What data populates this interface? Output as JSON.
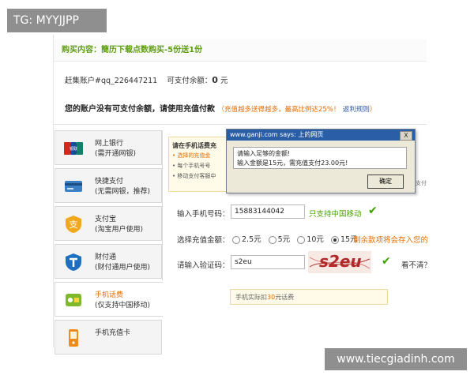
{
  "watermarks": {
    "top": "TG: MYYJJPP",
    "bottom": "www.tiecgiadinh.com"
  },
  "purchase": {
    "text": "购买内容：簡历下载点数购买-5份送1份"
  },
  "account": {
    "label": "赶集账户#qq_226447211",
    "balance_label": "可支付余额：",
    "balance_value": "0",
    "balance_unit": "元"
  },
  "notice": {
    "main": "您的账户没有可支付余额，请使用充值付款",
    "hint": "（充值越多送得越多，最高比例达25%！",
    "rules": "返利规则",
    "end": "）"
  },
  "methods": [
    {
      "line1": "网上银行",
      "line2": "(需开通网银)",
      "icon": "unionpay-icon"
    },
    {
      "line1": "快捷支付",
      "line2": "(无需网银，推荐)",
      "icon": "card-icon"
    },
    {
      "line1": "支付宝",
      "line2": "(淘宝用户使用)",
      "icon": "alipay-icon"
    },
    {
      "line1": "财付通",
      "line2": "(财付通用户使用)",
      "icon": "tenpay-icon"
    },
    {
      "line1": "手机话费",
      "line2": "(仅支持中国移动)",
      "icon": "mobile-pay-icon"
    },
    {
      "line1": "手机充值卡",
      "line2": "",
      "icon": "phone-card-icon"
    }
  ],
  "info_box": {
    "title": "请在手机话费充",
    "line1": "• 选择的充值金",
    "line2": "• 每个手机号号",
    "line3": "• 移动支付客服中",
    "right_text": "支付"
  },
  "form": {
    "phone_label": "输入手机号码：",
    "phone_value": "15883144042",
    "phone_note": "只支持中国移动",
    "amount_label": "选择充值金额：",
    "amount_options": [
      "2.5元",
      "5元",
      "10元",
      "15元"
    ],
    "amount_selected": "15元",
    "amount_note": "剩余款项将会存入您的",
    "captcha_label": "请输入验证码：",
    "captcha_value": "s2eu",
    "captcha_image_text": "s2eu",
    "captcha_refresh": "看不清？",
    "note_prefix": "手机实际扣",
    "note_amount": "30",
    "note_suffix": "元话费"
  },
  "dialog": {
    "title": "www.ganji.com says: 上的网页",
    "line1": "请输入足够的金额!",
    "line2": "输入金额是15元，需充值支付23.00元!",
    "ok": "确定",
    "close": "X"
  },
  "colors": {
    "green": "#5e9d12",
    "orange": "#e86d00",
    "link_blue": "#2a57a0",
    "title_bar": "#2a5fa8"
  }
}
